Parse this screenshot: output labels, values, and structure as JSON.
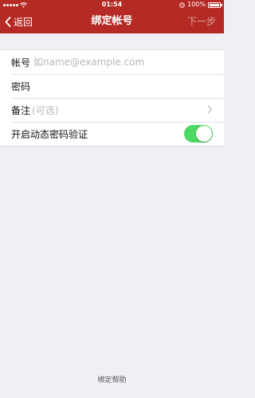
{
  "status_bar": {
    "time": "01:54",
    "battery_text": "100%",
    "battery_level": 1.0,
    "icons": [
      "signal-icon",
      "wifi-icon",
      "alarm-icon",
      "battery-icon"
    ]
  },
  "nav": {
    "back_label": "返回",
    "title": "绑定帐号",
    "next_label": "下一步",
    "bar_color": "#b52a24",
    "next_enabled": false
  },
  "form": {
    "account": {
      "label": "帐号",
      "placeholder": "如name@example.com",
      "value": ""
    },
    "password": {
      "label": "密码",
      "value": ""
    },
    "note": {
      "label": "备注",
      "hint": "(可选)"
    },
    "dynamic_password": {
      "label": "开启动态密码验证",
      "enabled": true,
      "toggle_color": "#4cd964"
    }
  },
  "footer": {
    "help_label": "绑定帮助"
  }
}
